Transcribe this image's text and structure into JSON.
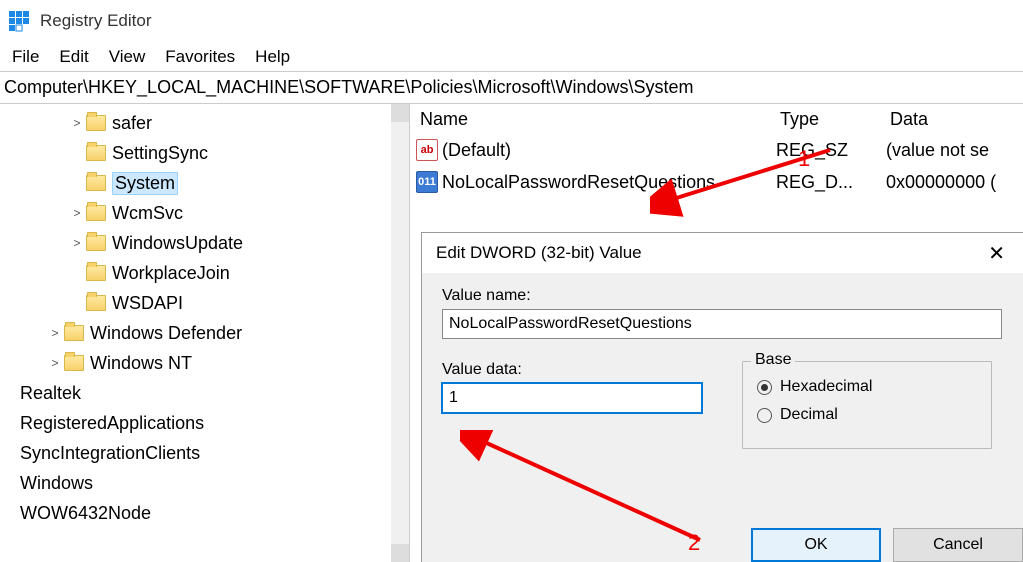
{
  "app": {
    "title": "Registry Editor"
  },
  "menubar": {
    "file": "File",
    "edit": "Edit",
    "view": "View",
    "favorites": "Favorites",
    "help": "Help"
  },
  "address": "Computer\\HKEY_LOCAL_MACHINE\\SOFTWARE\\Policies\\Microsoft\\Windows\\System",
  "tree": {
    "items": [
      {
        "label": "safer",
        "indent": 70,
        "expander": ">"
      },
      {
        "label": "SettingSync",
        "indent": 70,
        "expander": ""
      },
      {
        "label": "System",
        "indent": 70,
        "expander": "",
        "selected": true
      },
      {
        "label": "WcmSvc",
        "indent": 70,
        "expander": ">"
      },
      {
        "label": "WindowsUpdate",
        "indent": 70,
        "expander": ">"
      },
      {
        "label": "WorkplaceJoin",
        "indent": 70,
        "expander": ""
      },
      {
        "label": "WSDAPI",
        "indent": 70,
        "expander": ""
      },
      {
        "label": "Windows Defender",
        "indent": 48,
        "expander": ">"
      },
      {
        "label": "Windows NT",
        "indent": 48,
        "expander": ">"
      },
      {
        "label": "Realtek",
        "indent": 4,
        "expander": ""
      },
      {
        "label": "RegisteredApplications",
        "indent": 4,
        "expander": ""
      },
      {
        "label": "SyncIntegrationClients",
        "indent": 4,
        "expander": ""
      },
      {
        "label": "Windows",
        "indent": 4,
        "expander": ""
      },
      {
        "label": "WOW6432Node",
        "indent": 4,
        "expander": ""
      }
    ]
  },
  "list": {
    "header": {
      "name": "Name",
      "type": "Type",
      "data": "Data"
    },
    "rows": [
      {
        "icon": "sz",
        "name": "(Default)",
        "type": "REG_SZ",
        "data": "(value not se"
      },
      {
        "icon": "dw",
        "name": "NoLocalPasswordResetQuestions",
        "type": "REG_D...",
        "data": "0x00000000 ("
      }
    ]
  },
  "dialog": {
    "title": "Edit DWORD (32-bit) Value",
    "value_name_label": "Value name:",
    "value_name": "NoLocalPasswordResetQuestions",
    "value_data_label": "Value data:",
    "value_data": "1",
    "base_label": "Base",
    "hex": "Hexadecimal",
    "dec": "Decimal",
    "ok": "OK",
    "cancel": "Cancel"
  },
  "annotations": {
    "one": "1",
    "two": "2"
  }
}
